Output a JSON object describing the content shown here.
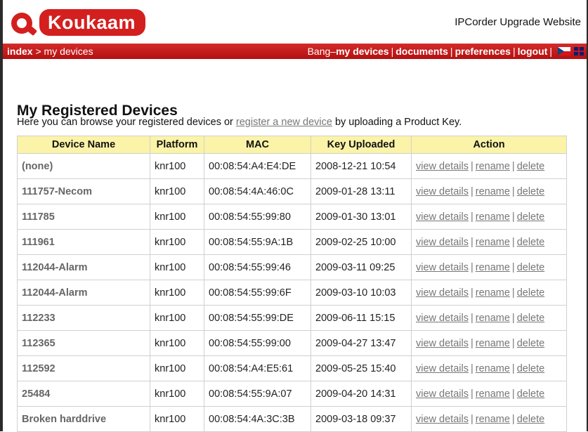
{
  "header": {
    "logo_text": "Koukaam",
    "site_title": "IPCorder Upgrade Website"
  },
  "nav": {
    "breadcrumb_home": "index",
    "breadcrumb_sep": " > ",
    "breadcrumb_current": "my devices",
    "user_name": "Bang",
    "user_dash": " – ",
    "links": [
      "my devices",
      "documents",
      "preferences",
      "logout"
    ],
    "flags": [
      "flag-cz-icon",
      "flag-uk-icon"
    ]
  },
  "main": {
    "title": "My Registered Devices",
    "intro_before": "Here you can browse your registered devices or ",
    "intro_link": "register a new device",
    "intro_after": " by uploading a Product Key."
  },
  "table": {
    "headers": [
      "Device Name",
      "Platform",
      "MAC",
      "Key Uploaded",
      "Action"
    ],
    "actions": [
      "view details",
      "rename",
      "delete"
    ],
    "rows": [
      [
        "(none)",
        "knr100",
        "00:08:54:A4:E4:DE",
        "2008-12-21 10:54"
      ],
      [
        "111757-Necom",
        "knr100",
        "00:08:54:4A:46:0C",
        "2009-01-28 13:11"
      ],
      [
        "111785",
        "knr100",
        "00:08:54:55:99:80",
        "2009-01-30 13:01"
      ],
      [
        "111961",
        "knr100",
        "00:08:54:55:9A:1B",
        "2009-02-25 10:00"
      ],
      [
        "112044-Alarm",
        "knr100",
        "00:08:54:55:99:46",
        "2009-03-11 09:25"
      ],
      [
        "112044-Alarm",
        "knr100",
        "00:08:54:55:99:6F",
        "2009-03-10 10:03"
      ],
      [
        "112233",
        "knr100",
        "00:08:54:55:99:DE",
        "2009-06-11 15:15"
      ],
      [
        "112365",
        "knr100",
        "00:08:54:55:99:00",
        "2009-04-27 13:47"
      ],
      [
        "112592",
        "knr100",
        "00:08:54:A4:E5:61",
        "2009-05-25 15:40"
      ],
      [
        "25484",
        "knr100",
        "00:08:54:55:9A:07",
        "2009-04-20 14:31"
      ],
      [
        "Broken harddrive",
        "knr100",
        "00:08:54:4A:3C:3B",
        "2009-03-18 09:37"
      ]
    ]
  },
  "colors": {
    "brand_red": "#d41f1f",
    "header_yellow": "#fbf3a8",
    "link_gray": "#777777"
  }
}
